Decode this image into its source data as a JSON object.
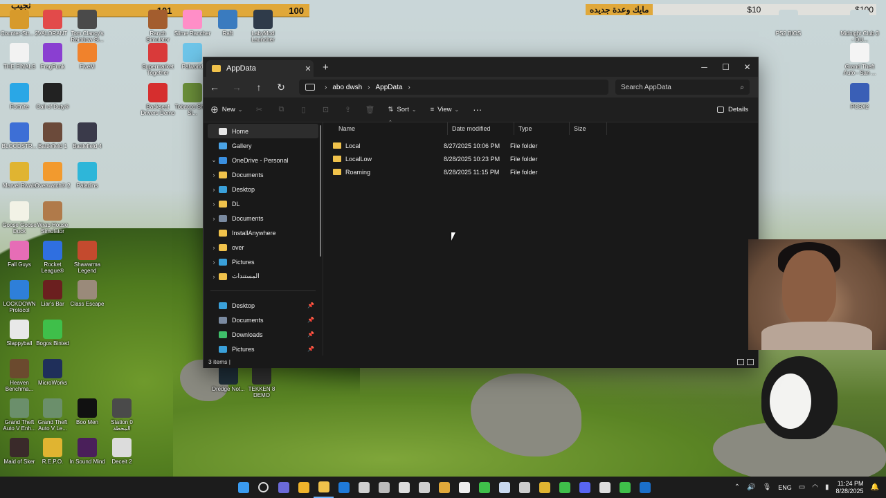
{
  "overlay": {
    "left_label": "نجيب 100",
    "left_mid": "101",
    "left_right": "100",
    "right_arabic": "مايك وعدة جديده",
    "right_mid": "$10",
    "right_end": "$100"
  },
  "desktop_icons": [
    {
      "label": "Counter-Str... 2",
      "color": "#d79a2b"
    },
    {
      "label": "VALORANT",
      "color": "#e24a4a"
    },
    {
      "label": "Tom Clancy's Rainbow Si...",
      "color": "#4a4a4a"
    },
    {
      "label": "Ranch Simulator",
      "color": "#a35d2e"
    },
    {
      "label": "Slime Rancher",
      "color": "#ff8ec7"
    },
    {
      "label": "Raft",
      "color": "#3a7bbf"
    },
    {
      "label": "LabyMod Launcher",
      "color": "#2f3b4a"
    },
    {
      "label": "THE FINALS",
      "color": "#f2f2f2"
    },
    {
      "label": "FragPunk",
      "color": "#8a3fd1"
    },
    {
      "label": "FiveM",
      "color": "#f0822c"
    },
    {
      "label": "Supermarket Together",
      "color": "#d93a3a"
    },
    {
      "label": "Palworld",
      "color": "#6ec5e9"
    },
    {
      "label": "Fortnite",
      "color": "#2aa7e6"
    },
    {
      "label": "Call of Duty®",
      "color": "#222222"
    },
    {
      "label": "Backseat Drivers Demo",
      "color": "#d62e2e"
    },
    {
      "label": "Tobacco Shop Si...",
      "color": "#6b8f3a"
    },
    {
      "label": "BLOODSTR...",
      "color": "#3d6fd6"
    },
    {
      "label": "Battlefield 1",
      "color": "#6b4a3a"
    },
    {
      "label": "Battlefield 4",
      "color": "#3a3a4a"
    },
    {
      "label": "Marvel Rivals",
      "color": "#e0b431"
    },
    {
      "label": "Overwatch® 2",
      "color": "#f29a2e"
    },
    {
      "label": "Paladins",
      "color": "#2eb6d9"
    },
    {
      "label": "Goose Goose Duck",
      "color": "#f2f2e6"
    },
    {
      "label": "Wrap House Simulator",
      "color": "#b07a4a"
    },
    {
      "label": "Fall Guys",
      "color": "#e66db6"
    },
    {
      "label": "Rocket League®",
      "color": "#2f6fe0"
    },
    {
      "label": "Shawarma Legend",
      "color": "#c44a2e"
    },
    {
      "label": "LOCKDOWN Protocol",
      "color": "#2e7fd9"
    },
    {
      "label": "Liar's Bar",
      "color": "#6b1f1f"
    },
    {
      "label": "Class Escape",
      "color": "#9a8a7a"
    },
    {
      "label": "Slappyball",
      "color": "#e8e8e8"
    },
    {
      "label": "Bogos Binted",
      "color": "#3fbf4a"
    },
    {
      "label": "Heaven Benchma...",
      "color": "#6b4a2e"
    },
    {
      "label": "MicroWorks",
      "color": "#1f2f5a"
    },
    {
      "label": "Grand Theft Auto V Enh...",
      "color": "#6b8f6b"
    },
    {
      "label": "Grand Theft Auto V Le...",
      "color": "#6b8f6b"
    },
    {
      "label": "Boo Men",
      "color": "#111111"
    },
    {
      "label": "Station 0 المحطة",
      "color": "#4a4a4a"
    },
    {
      "label": "Maid of Sker",
      "color": "#3a2a2a"
    },
    {
      "label": "R.E.P.O.",
      "color": "#e0b431"
    },
    {
      "label": "In Sound Mind",
      "color": "#4a1f5a"
    },
    {
      "label": "Deceit 2",
      "color": "#dcdcdc"
    },
    {
      "label": "Dredge Not...",
      "color": "#1f2f3a"
    },
    {
      "label": "TEKKEN 8 DEMO",
      "color": "#2f2f2f"
    },
    {
      "label": "PS2 BIOS",
      "color": "#c9d6d8"
    },
    {
      "label": "Midnight Club 3 - DU...",
      "color": "#c9d6d8"
    },
    {
      "label": "Grand Theft Auto - San ...",
      "color": "#f4f4f4"
    },
    {
      "label": "PCSX2",
      "color": "#3a5fb6"
    }
  ],
  "explorer": {
    "tab_title": "AppData",
    "path": [
      "abo dwsh",
      "AppData"
    ],
    "search_placeholder": "Search AppData",
    "toolbar": {
      "new": "New",
      "sort": "Sort",
      "view": "View",
      "more": "···",
      "details": "Details"
    },
    "nav_items": [
      {
        "label": "Home",
        "chev": "",
        "color": "#e6e6e6",
        "selected": true,
        "pin": false
      },
      {
        "label": "Gallery",
        "chev": "",
        "color": "#4aa3e6",
        "selected": false,
        "pin": false
      },
      {
        "label": "OneDrive - Personal",
        "chev": "⌄",
        "color": "#3a8fe0",
        "selected": false,
        "pin": false
      },
      {
        "label": "Documents",
        "chev": "›",
        "color": "#f0c24b",
        "selected": false,
        "pin": false
      },
      {
        "label": "Desktop",
        "chev": "›",
        "color": "#3aa0d9",
        "selected": false,
        "pin": false
      },
      {
        "label": "DL",
        "chev": "›",
        "color": "#f0c24b",
        "selected": false,
        "pin": false
      },
      {
        "label": "Documents",
        "chev": "›",
        "color": "#7a8aa0",
        "selected": false,
        "pin": false
      },
      {
        "label": "InstallAnywhere",
        "chev": "",
        "color": "#f0c24b",
        "selected": false,
        "pin": false
      },
      {
        "label": "over",
        "chev": "›",
        "color": "#f0c24b",
        "selected": false,
        "pin": false
      },
      {
        "label": "Pictures",
        "chev": "›",
        "color": "#3aa0d9",
        "selected": false,
        "pin": false
      },
      {
        "label": "المستندات",
        "chev": "›",
        "color": "#f0c24b",
        "selected": false,
        "pin": false
      }
    ],
    "quick_access": [
      {
        "label": "Desktop",
        "color": "#3aa0d9"
      },
      {
        "label": "Documents",
        "color": "#7a8aa0"
      },
      {
        "label": "Downloads",
        "color": "#3fbf6a"
      },
      {
        "label": "Pictures",
        "color": "#3aa0d9"
      }
    ],
    "columns": [
      "Name",
      "Date modified",
      "Type",
      "Size"
    ],
    "files": [
      {
        "name": "Local",
        "date": "8/27/2025 10:06 PM",
        "type": "File folder",
        "size": ""
      },
      {
        "name": "LocalLow",
        "date": "8/28/2025 10:23 PM",
        "type": "File folder",
        "size": ""
      },
      {
        "name": "Roaming",
        "date": "8/28/2025 11:15 PM",
        "type": "File folder",
        "size": ""
      }
    ],
    "status": "3 items  |"
  },
  "taskbar": {
    "language": "ENG",
    "time": "11:24 PM",
    "date": "8/28/2025",
    "apps": [
      {
        "name": "start",
        "color": "#3a9bf0"
      },
      {
        "name": "search",
        "color": "#dddddd"
      },
      {
        "name": "teams",
        "color": "#6b6ad8"
      },
      {
        "name": "yellow-app",
        "color": "#f0b42b"
      },
      {
        "name": "file-explorer",
        "color": "#f0c24b"
      },
      {
        "name": "outlook",
        "color": "#1f7ad9"
      },
      {
        "name": "store",
        "color": "#cfcfcf"
      },
      {
        "name": "unity",
        "color": "#bbbbbb"
      },
      {
        "name": "openai",
        "color": "#dddddd"
      },
      {
        "name": "app-10",
        "color": "#cfcfcf"
      },
      {
        "name": "stack-app",
        "color": "#e0a83a"
      },
      {
        "name": "capcut",
        "color": "#eeeeee"
      },
      {
        "name": "xbox",
        "color": "#3fbf4a"
      },
      {
        "name": "steam-store",
        "color": "#c9d9ef"
      },
      {
        "name": "bios-app",
        "color": "#cccccc"
      },
      {
        "name": "chrome",
        "color": "#e0b431"
      },
      {
        "name": "chrome-2",
        "color": "#3fbf4a"
      },
      {
        "name": "discord",
        "color": "#5865f2"
      },
      {
        "name": "obs",
        "color": "#dddddd"
      },
      {
        "name": "game-pass",
        "color": "#3fbf4a"
      },
      {
        "name": "steam",
        "color": "#1b6fc9"
      }
    ]
  }
}
